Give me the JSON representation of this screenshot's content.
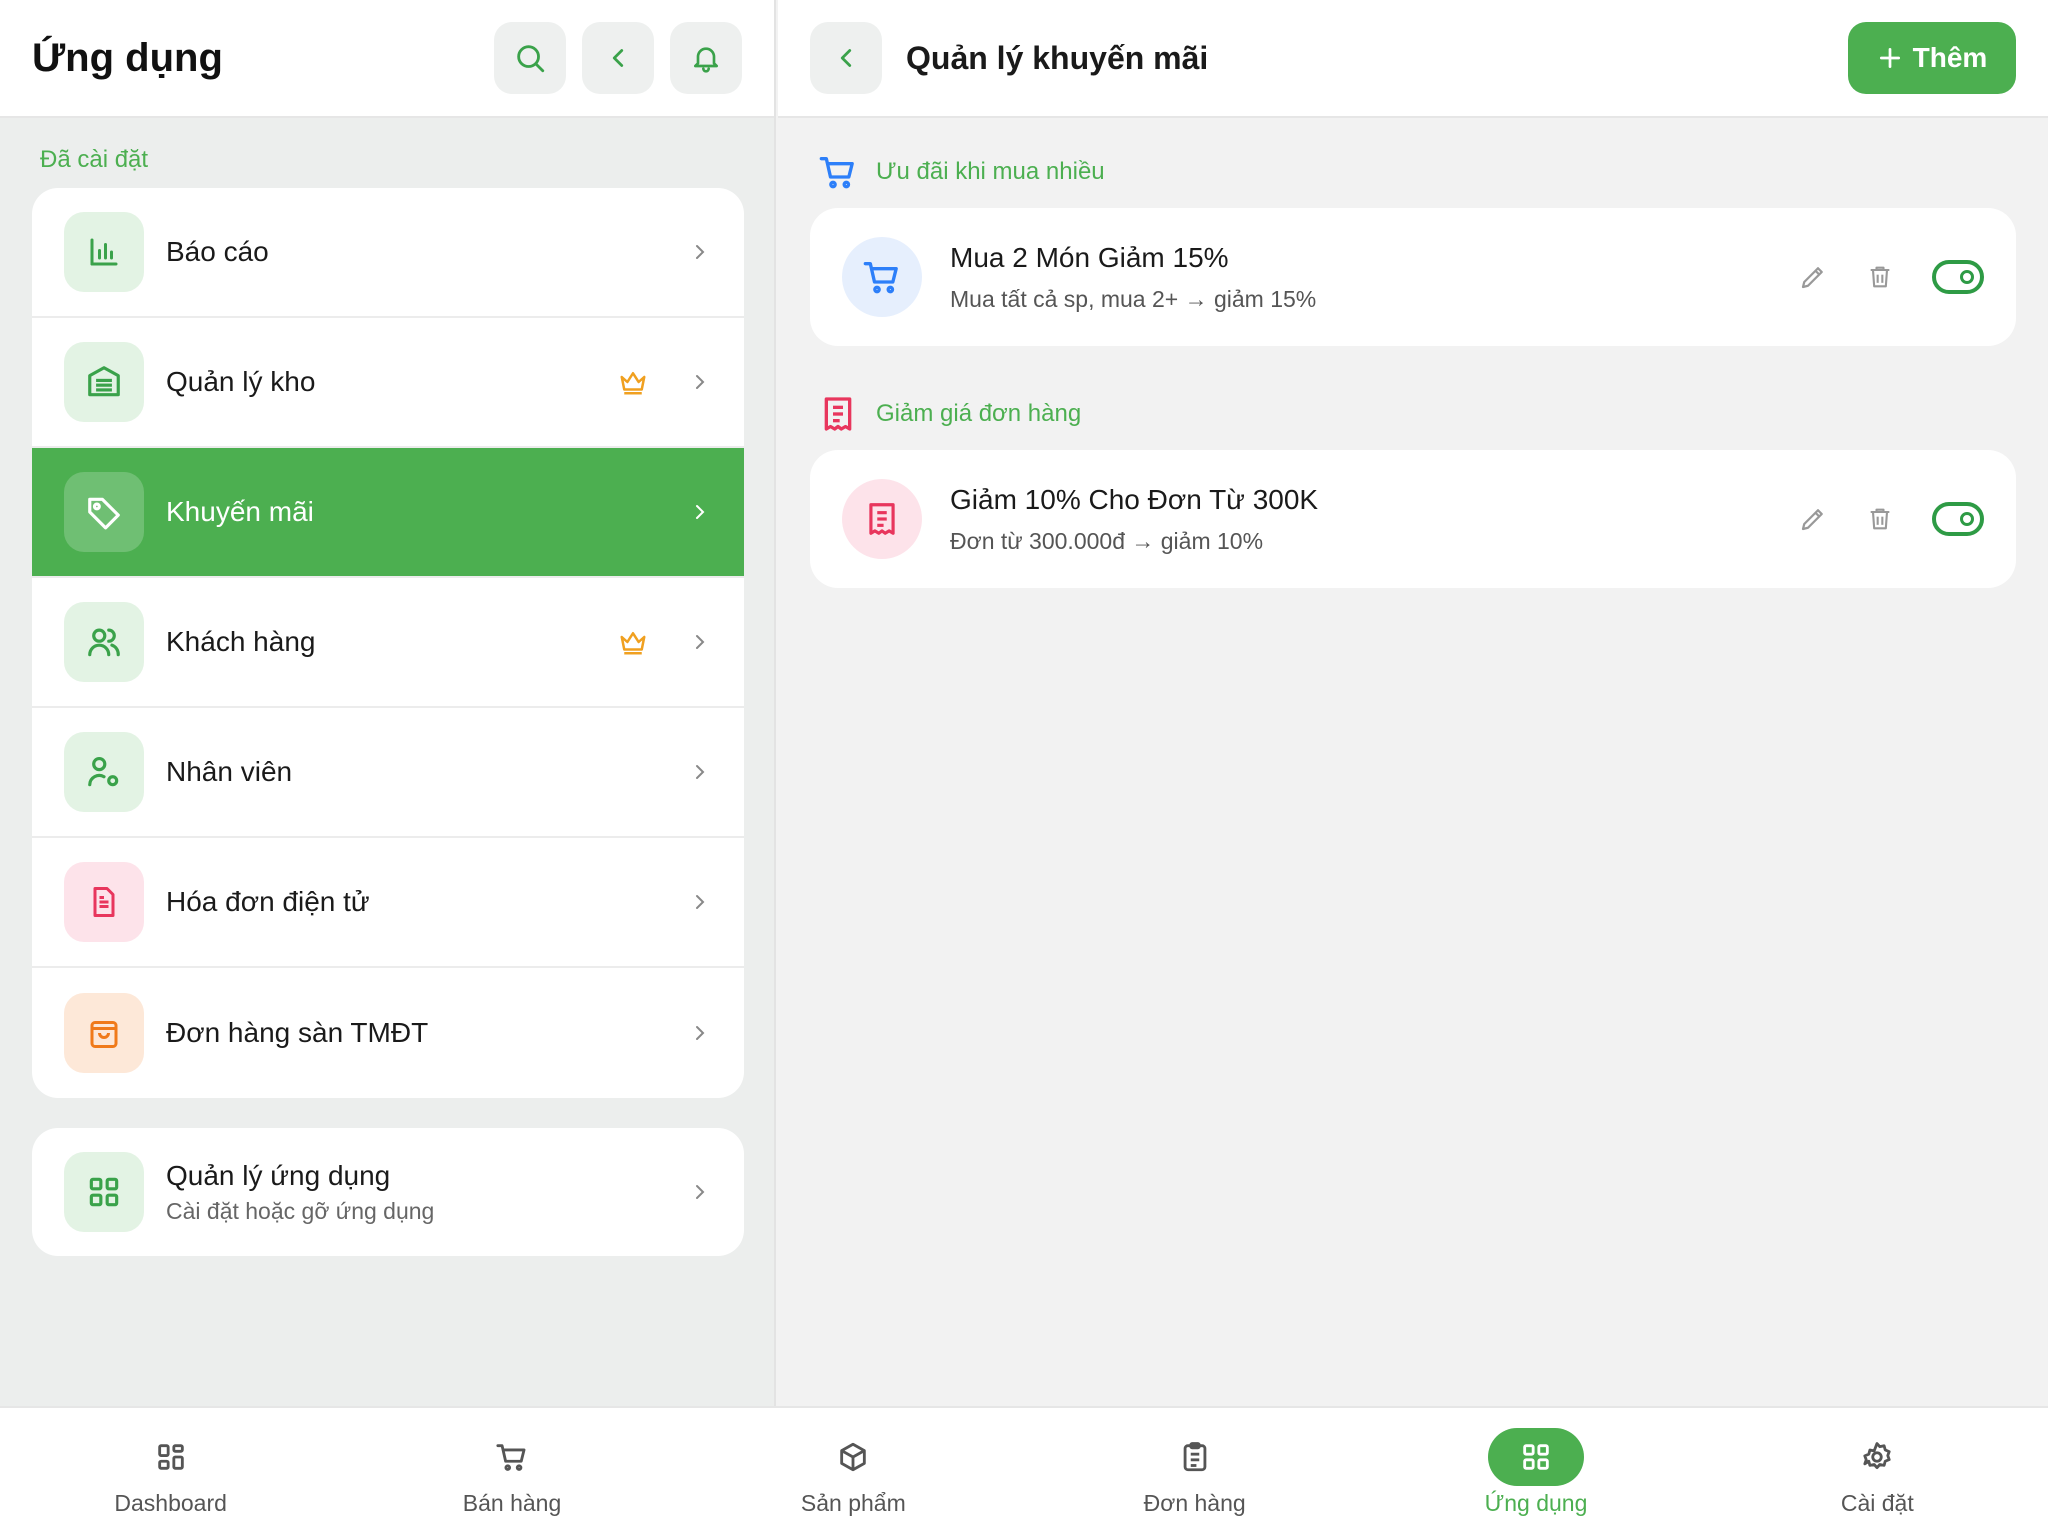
{
  "left_panel": {
    "title": "Ứng dụng",
    "section_label": "Đã cài đặt",
    "items": [
      {
        "label": "Báo cáo",
        "icon": "bar-chart-icon",
        "premium": false,
        "active": false
      },
      {
        "label": "Quản lý kho",
        "icon": "warehouse-icon",
        "premium": true,
        "active": false
      },
      {
        "label": "Khuyến mãi",
        "icon": "tag-icon",
        "premium": false,
        "active": true
      },
      {
        "label": "Khách hàng",
        "icon": "users-icon",
        "premium": true,
        "active": false
      },
      {
        "label": "Nhân viên",
        "icon": "user-cog-icon",
        "premium": false,
        "active": false
      },
      {
        "label": "Hóa đơn điện tử",
        "icon": "invoice-icon",
        "premium": false,
        "active": false
      },
      {
        "label": "Đơn hàng sàn TMĐT",
        "icon": "shopping-bag-icon",
        "premium": false,
        "active": false
      }
    ],
    "app_manager": {
      "title": "Quản lý ứng dụng",
      "subtitle": "Cài đặt hoặc gỡ ứng dụng"
    }
  },
  "right_panel": {
    "title": "Quản lý khuyến mãi",
    "add_label": "Thêm",
    "groups": [
      {
        "label": "Ưu đãi khi mua nhiều",
        "promos": [
          {
            "title": "Mua 2 Món Giảm 15%",
            "subtitle": "Mua tất cả sp, mua 2+ → giảm 15%",
            "enabled": true
          }
        ]
      },
      {
        "label": "Giảm giá đơn hàng",
        "promos": [
          {
            "title": "Giảm 10% Cho Đơn Từ 300K",
            "subtitle": "Đơn từ 300.000đ → giảm 10%",
            "enabled": true
          }
        ]
      }
    ]
  },
  "bottom_nav": {
    "tabs": [
      {
        "label": "Dashboard",
        "icon": "dashboard-icon"
      },
      {
        "label": "Bán hàng",
        "icon": "cart-icon"
      },
      {
        "label": "Sản phẩm",
        "icon": "box-icon"
      },
      {
        "label": "Đơn hàng",
        "icon": "clipboard-icon"
      },
      {
        "label": "Ứng dụng",
        "icon": "apps-grid-icon"
      },
      {
        "label": "Cài đặt",
        "icon": "settings-icon"
      }
    ],
    "active_index": 4
  },
  "colors": {
    "accent": "#4caf50",
    "blue": "#2d7ff9",
    "red": "#e8365d",
    "orange": "#f07a1a",
    "gold": "#f0a020"
  }
}
